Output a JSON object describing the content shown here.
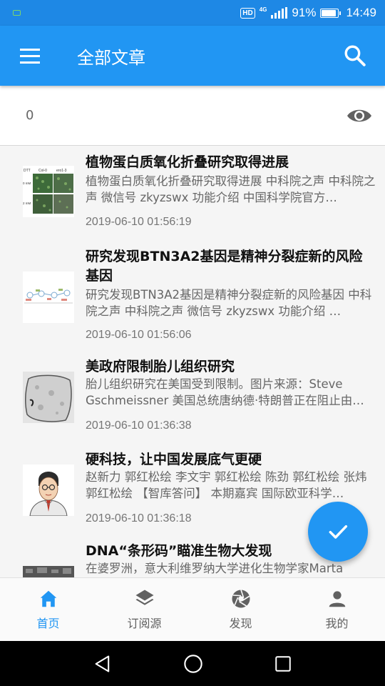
{
  "status_bar": {
    "hd": "HD",
    "network": "4G",
    "battery": "91%",
    "battery_level": 0.91,
    "time": "14:49"
  },
  "app_bar": {
    "title": "全部文章",
    "menu_icon": "menu-icon",
    "search_icon": "search-icon"
  },
  "counter": {
    "value": "0",
    "eye_icon": "eye-icon"
  },
  "articles": [
    {
      "title": "植物蛋白质氧化折叠研究取得进展",
      "summary": " 植物蛋白质氧化折叠研究取得进展 中科院之声 中科院之声 微信号 zkyzswx 功能介绍 中国科学院官方…",
      "date": "2019-06-10 01:56:19",
      "thumb_labels": [
        "DTT",
        "Col-0",
        "ero1-3",
        "0 mM",
        "2 mM"
      ]
    },
    {
      "title": "研究发现BTN3A2基因是精神分裂症新的风险基因",
      "summary": " 研究发现BTN3A2基因是精神分裂症新的风险基因 中科院之声 中科院之声 微信号 zkyzswx 功能介绍 …",
      "date": "2019-06-10 01:56:06"
    },
    {
      "title": "美政府限制胎儿组织研究",
      "summary": " 胎儿组织研究在美国受到限制。图片来源：Steve Gschmeissner 美国总统唐纳德·特朗普正在阻止由…",
      "date": "2019-06-10 01:36:38"
    },
    {
      "title": "硬科技，让中国发展底气更硬",
      "summary": " 赵新力 郭红松绘 李文宇 郭红松绘 陈劲 郭红松绘 张炜 郭红松绘 【智库答问】 本期嘉宾 国际欧亚科学…",
      "date": "2019-06-10 01:36:18"
    },
    {
      "title": "DNA“条形码”瞄准生物大发现",
      "summary": " 在婆罗洲，意大利维罗纳大学进化生物学家Marta"
    }
  ],
  "fab": {
    "icon": "check-icon"
  },
  "bottom_nav": [
    {
      "label": "首页",
      "icon": "home-icon",
      "active": true
    },
    {
      "label": "订阅源",
      "icon": "layers-icon",
      "active": false
    },
    {
      "label": "发现",
      "icon": "camera-aperture-icon",
      "active": false
    },
    {
      "label": "我的",
      "icon": "person-icon",
      "active": false
    }
  ],
  "colors": {
    "primary": "#2196f3",
    "status_bar": "#1e88e5",
    "active_nav": "#2196f3",
    "inactive_nav": "#616161"
  }
}
